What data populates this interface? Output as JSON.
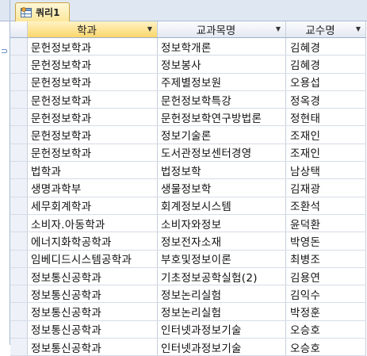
{
  "tab": {
    "title": "쿼리1",
    "icon": "query-table-icon"
  },
  "columns": [
    {
      "label": "학과",
      "sorted": true
    },
    {
      "label": "교과목명",
      "sorted": false
    },
    {
      "label": "교수명",
      "sorted": false
    }
  ],
  "rows": [
    [
      "문헌정보학과",
      "정보학개론",
      "김혜경"
    ],
    [
      "문헌정보학과",
      "정보봉사",
      "김혜경"
    ],
    [
      "문헌정보학과",
      "주제별정보원",
      "오용섭"
    ],
    [
      "문헌정보학과",
      "문헌정보학특강",
      "정옥경"
    ],
    [
      "문헌정보학과",
      "문헌정보학연구방법론",
      "정현태"
    ],
    [
      "문헌정보학과",
      "정보기술론",
      "조재인"
    ],
    [
      "문헌정보학과",
      "도서관정보센터경영",
      "조재인"
    ],
    [
      "법학과",
      "법정보학",
      "남상택"
    ],
    [
      "생명과학부",
      "생물정보학",
      "김재광"
    ],
    [
      "세무회계학과",
      "회계정보시스템",
      "조환석"
    ],
    [
      "소비자.아동학과",
      "소비자와정보",
      "윤덕환"
    ],
    [
      "에너지화학공학과",
      "정보전자소재",
      "박영돈"
    ],
    [
      "임베디드시스템공학과",
      "부호및정보이론",
      "최병조"
    ],
    [
      "정보통신공학과",
      "기초정보공학실험(2)",
      "김용연"
    ],
    [
      "정보통신공학과",
      "정보논리실험",
      "김익수"
    ],
    [
      "정보통신공학과",
      "정보논리실험",
      "박정훈"
    ],
    [
      "정보통신공학과",
      "인터넷과정보기술",
      "오승호"
    ],
    [
      "정보통신공학과",
      "인터넷과정보기술",
      "오승호"
    ]
  ],
  "colors": {
    "sorted_header": "#fbd66b",
    "grid_line": "#c6cfdc"
  }
}
